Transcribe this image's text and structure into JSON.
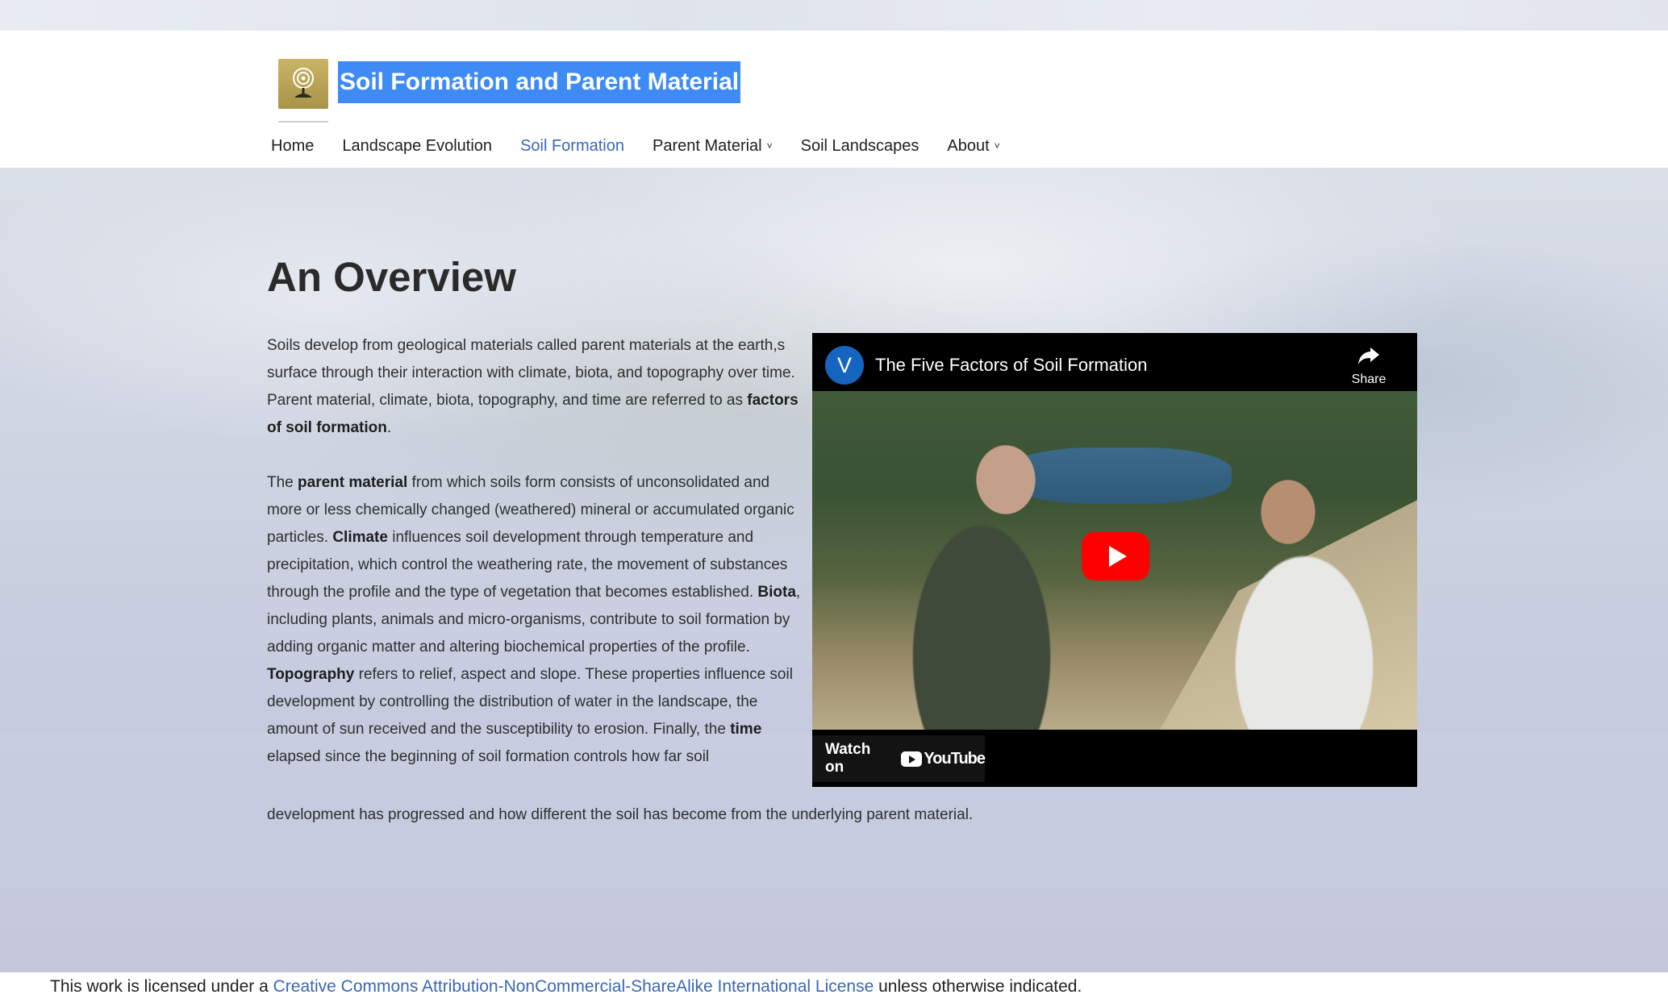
{
  "site": {
    "title": "Soil Formation and Parent Material",
    "logo_icon": "tree-logo-icon"
  },
  "nav": {
    "items": [
      {
        "label": "Home",
        "active": false,
        "has_dropdown": false
      },
      {
        "label": "Landscape Evolution",
        "active": false,
        "has_dropdown": false
      },
      {
        "label": "Soil Formation",
        "active": true,
        "has_dropdown": false
      },
      {
        "label": "Parent Material",
        "active": false,
        "has_dropdown": true
      },
      {
        "label": "Soil Landscapes",
        "active": false,
        "has_dropdown": false
      },
      {
        "label": "About",
        "active": false,
        "has_dropdown": true
      }
    ],
    "chevron": "˅"
  },
  "main": {
    "heading": "An Overview",
    "p1": {
      "text": "Soils develop from geological materials called parent materials at the earth,s surface through their interaction with climate, biota, and topography over time. Parent material, climate, biota, topography, and time are referred to as ",
      "bold": "factors of soil formation",
      "end": "."
    },
    "p2": {
      "t0": "The ",
      "b_parent": "parent material",
      "t1": " from which soils form consists of unconsolidated and more or less chemically changed (weathered) mineral or accumulated organic particles. ",
      "b_climate": "Climate",
      "t2": " influences soil development through temperature and precipitation, which control the weathering rate, the movement of substances through the profile and the type of vegetation that becomes established. ",
      "b_biota": "Biota",
      "t3": ", including plants, animals and micro-organisms, contribute to soil formation by adding organic matter and altering biochemical properties of the profile. ",
      "b_topo": "Topography",
      "t4": " refers to relief, aspect and slope. These properties influence soil development by controlling the distribution of water in the landscape, the amount of sun received and the susceptibility to erosion. Finally, the ",
      "b_time": "time",
      "t5": " elapsed since the beginning of soil formation controls how far soil",
      "last_line": "development has progressed and how different the soil has become from the underlying parent material."
    }
  },
  "video": {
    "channel_initial": "V",
    "title": "The Five Factors of Soil Formation",
    "share_label": "Share",
    "watch_on": "Watch on",
    "youtube_word": "YouTube"
  },
  "footer": {
    "prefix": "This work is licensed under a ",
    "link": "Creative Commons Attribution-NonCommercial-ShareAlike International License",
    "suffix": " unless otherwise indicated."
  }
}
